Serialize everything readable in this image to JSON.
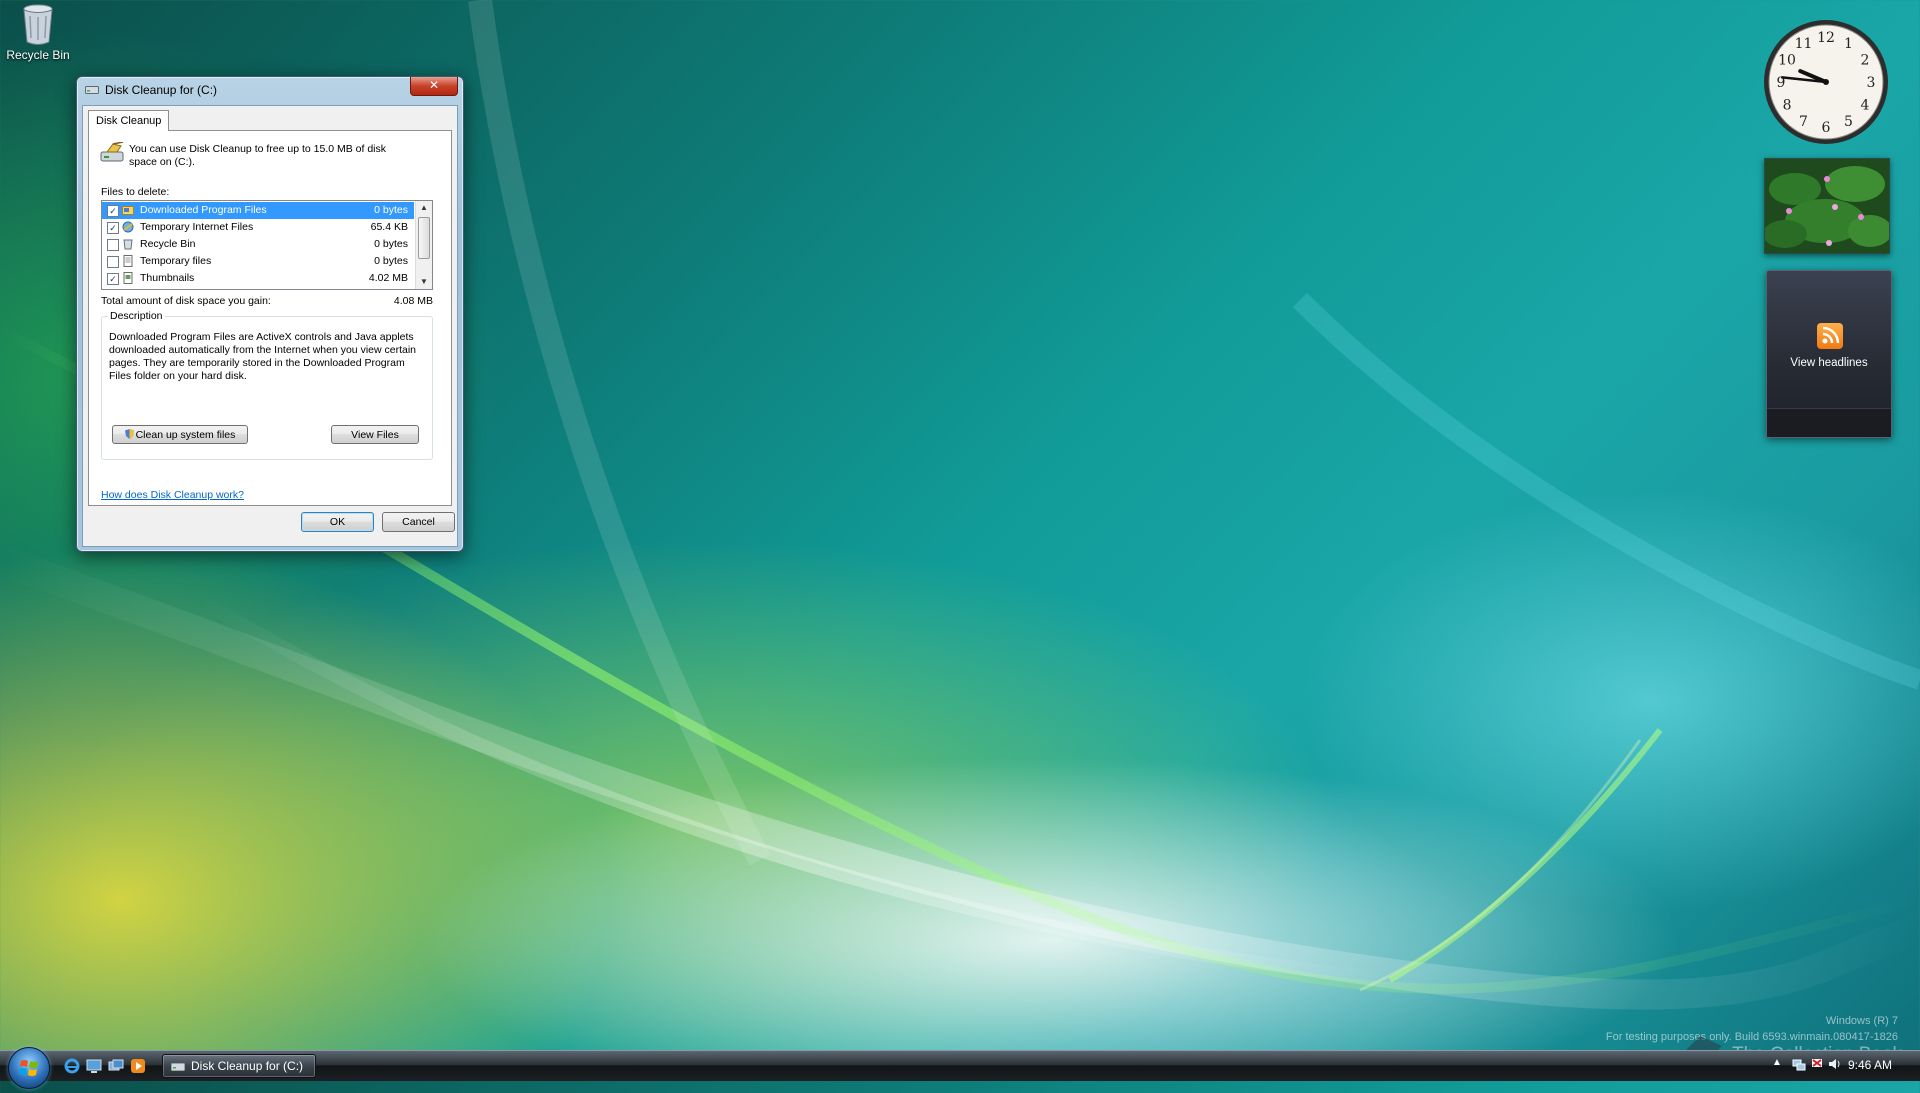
{
  "desktop": {
    "icons": [
      {
        "label": "Recycle Bin",
        "icon": "recycle-bin-icon"
      }
    ]
  },
  "dialog": {
    "title": "Disk Cleanup for  (C:)",
    "close_label": "✕",
    "tab_label": "Disk Cleanup",
    "intro_text": "You can use Disk Cleanup to free up to 15.0 MB of disk space on  (C:).",
    "files_label": "Files to delete:",
    "files": [
      {
        "name": "Downloaded Program Files",
        "size": "0 bytes",
        "checked": true,
        "selected": true
      },
      {
        "name": "Temporary Internet Files",
        "size": "65.4 KB",
        "checked": true,
        "selected": false
      },
      {
        "name": "Recycle Bin",
        "size": "0 bytes",
        "checked": false,
        "selected": false
      },
      {
        "name": "Temporary files",
        "size": "0 bytes",
        "checked": false,
        "selected": false
      },
      {
        "name": "Thumbnails",
        "size": "4.02 MB",
        "checked": true,
        "selected": false
      }
    ],
    "total_label": "Total amount of disk space you gain:",
    "total_value": "4.08 MB",
    "description_legend": "Description",
    "description_text": "Downloaded Program Files are ActiveX controls and Java applets downloaded automatically from the Internet when you view certain pages. They are temporarily stored in the Downloaded Program Files folder on your hard disk.",
    "cleanup_system_label": "Clean up system files",
    "view_files_label": "View Files",
    "help_link": "How does Disk Cleanup work?",
    "ok_label": "OK",
    "cancel_label": "Cancel"
  },
  "gadgets": {
    "clock": {
      "hour": 9,
      "minute": 46
    },
    "feeds_label": "View headlines"
  },
  "watermark": {
    "version": "Windows (R) 7",
    "build": "For testing purposes only. Build 6593.winmain.080417-1826",
    "brand": "The Collection Book"
  },
  "taskbar": {
    "task_button_label": "Disk Cleanup for  (C:)",
    "time": "9:46 AM"
  },
  "colors": {
    "selection": "#3399ff",
    "link": "#0066cc",
    "close_button": "#c8412a"
  }
}
